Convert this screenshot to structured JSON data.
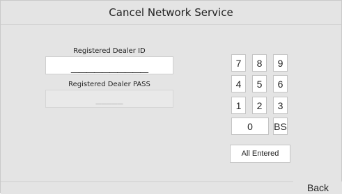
{
  "header": {
    "title": "Cancel Network Service"
  },
  "form": {
    "dealer_id_label": "Registered Dealer ID",
    "dealer_id_mask": "__________",
    "dealer_pass_label": "Registered Dealer PASS",
    "dealer_pass_mask": "_____"
  },
  "keypad": {
    "keys": [
      "7",
      "8",
      "9",
      "4",
      "5",
      "6",
      "1",
      "2",
      "3"
    ],
    "zero": "0",
    "backspace": "BS",
    "all_entered": "All Entered"
  },
  "footer": {
    "back_label": "Back"
  }
}
